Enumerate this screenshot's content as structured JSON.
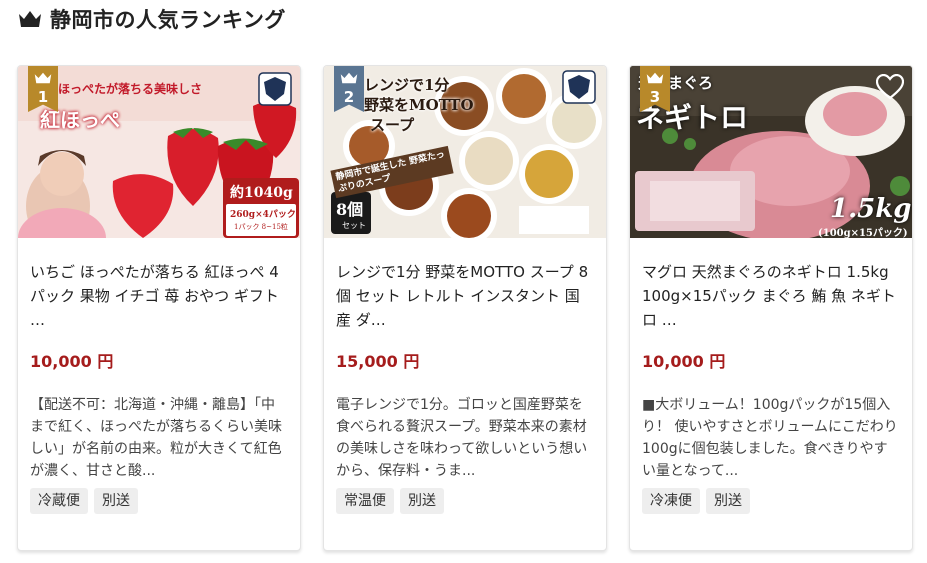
{
  "header": {
    "title": "静岡市の人気ランキング",
    "icon": "crown-icon"
  },
  "colors": {
    "accent_price": "#a51c1c",
    "rank_gold": "#b8892a",
    "rank_blue": "#5a7592"
  },
  "items": [
    {
      "rank": "1",
      "image_text": {
        "line1": "ほっぺたが落ちる美味しさ",
        "line2": "紅ほっぺ",
        "weight": "約1040g",
        "pack": "260g×4パック",
        "pack_sub": "1パック 8~15粒"
      },
      "title": "いちご ほっぺたが落ちる 紅ほっぺ 4パック 果物 イチゴ 苺 おやつ ギフト …",
      "price": "10,000 円",
      "description": "【配送不可：北海道・沖縄・離島】「中まで紅く、ほっぺたが落ちるくらい美味しい」が名前の由来。粒が大きくて紅色が濃く、甘さと酸...",
      "tags": [
        "冷蔵便",
        "別送"
      ]
    },
    {
      "rank": "2",
      "image_text": {
        "line1": "レンジで1分",
        "line2": "野菜をMOTTO",
        "line3": "スープ",
        "sub": "静岡市で誕生した 野菜たっぷりのスープ",
        "count": "8個",
        "count_sub": "セット"
      },
      "title": "レンジで1分 野菜をMOTTO スープ 8個 セット レトルト インスタント 国産 ダ…",
      "price": "15,000 円",
      "description": "電子レンジで1分。ゴロッと国産野菜を食べられる贅沢スープ。野菜本来の素材の美味しさを味わって欲しいという想いから、保存料・うま...",
      "tags": [
        "常温便",
        "別送"
      ]
    },
    {
      "rank": "3",
      "image_text": {
        "line1": "天然まぐろ",
        "line2": "ネギトロ",
        "weight": "1.5kg",
        "pack": "(100g×15パック)"
      },
      "title": "マグロ 天然まぐろのネギトロ 1.5kg 100g×15パック まぐろ 鮪 魚 ネギトロ …",
      "price": "10,000 円",
      "description": "■大ボリューム！100gパックが15個入り！ 使いやすさとボリュームにこだわり100gに個包装しました。食べきりやすい量となって...",
      "tags": [
        "冷凍便",
        "別送"
      ]
    }
  ]
}
